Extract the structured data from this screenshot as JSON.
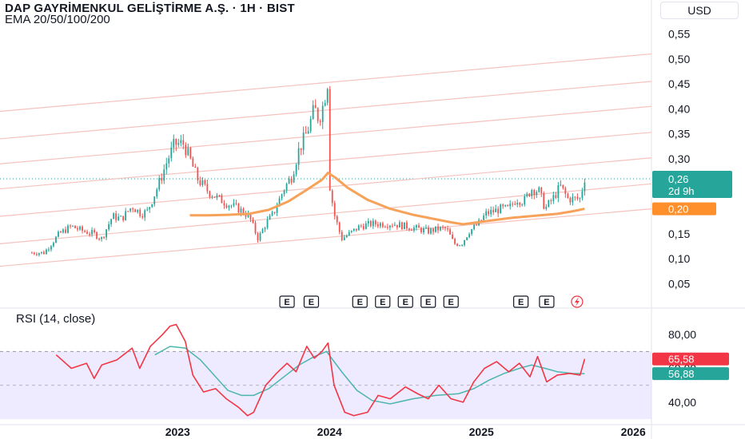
{
  "header": {
    "title": "DAP GAYRİMENKUL GELİŞTİRME A.Ş. · 1H · BIST",
    "indicator": "EMA 20/50/100/200",
    "currency": "USD"
  },
  "rsi_panel": {
    "label": "RSI (14, close)",
    "value_label": "65,58",
    "ma_label": "56,88",
    "hidden_level_label": "60,00"
  },
  "price_badges": {
    "last_price": "0,26",
    "countdown": "2d 9h",
    "ema_price": "0,20"
  },
  "event_markers": [
    "E",
    "E",
    "E",
    "E",
    "E",
    "E",
    "E",
    "E",
    "E"
  ],
  "colors": {
    "up": "#26a69a",
    "down": "#ef5350",
    "ema": "#f7a25a",
    "channel": "#f5c2bd",
    "rsi_line": "#f23645",
    "rsi_ma": "#4db6ac",
    "rsi_band": "#eeeaff",
    "last_price_badge": "#26a69a",
    "ema_badge": "#ff8f2a",
    "rsi_badge": "#f23645",
    "rsi_ma_badge": "#26a69a"
  },
  "chart_data": [
    {
      "type": "candlestick",
      "title": "DAP GAYRİMENKUL GELİŞTİRME A.Ş. · 1H · BIST",
      "y_ticks": [
        "0,55",
        "0,50",
        "0,45",
        "0,40",
        "0,35",
        "0,30",
        "0,25",
        "0,20",
        "0,15",
        "0,10",
        "0,05"
      ],
      "y_values": [
        0.55,
        0.5,
        0.45,
        0.4,
        0.35,
        0.3,
        0.25,
        0.2,
        0.15,
        0.1,
        0.05
      ],
      "x_ticks": [
        "2023",
        "2024",
        "2025",
        "2026"
      ],
      "x_tick_years": [
        2023,
        2024,
        2025,
        2026
      ],
      "ylim": [
        0.03,
        0.57
      ],
      "xlim": [
        2021.83,
        2026.12
      ],
      "last_price": 0.26,
      "ema_value": 0.2,
      "close_path": [
        [
          2022.04,
          0.112
        ],
        [
          2022.12,
          0.112
        ],
        [
          2022.22,
          0.15
        ],
        [
          2022.3,
          0.165
        ],
        [
          2022.38,
          0.155
        ],
        [
          2022.45,
          0.15
        ],
        [
          2022.5,
          0.14
        ],
        [
          2022.57,
          0.185
        ],
        [
          2022.63,
          0.18
        ],
        [
          2022.7,
          0.205
        ],
        [
          2022.76,
          0.19
        ],
        [
          2022.8,
          0.195
        ],
        [
          2022.87,
          0.245
        ],
        [
          2022.93,
          0.295
        ],
        [
          2022.98,
          0.33
        ],
        [
          2023.04,
          0.33
        ],
        [
          2023.08,
          0.3
        ],
        [
          2023.13,
          0.26
        ],
        [
          2023.2,
          0.235
        ],
        [
          2023.27,
          0.22
        ],
        [
          2023.33,
          0.21
        ],
        [
          2023.4,
          0.2
        ],
        [
          2023.47,
          0.185
        ],
        [
          2023.53,
          0.14
        ],
        [
          2023.58,
          0.17
        ],
        [
          2023.63,
          0.19
        ],
        [
          2023.7,
          0.24
        ],
        [
          2023.75,
          0.265
        ],
        [
          2023.8,
          0.32
        ],
        [
          2023.84,
          0.345
        ],
        [
          2023.87,
          0.37
        ],
        [
          2023.9,
          0.4
        ],
        [
          2023.93,
          0.38
        ],
        [
          2023.96,
          0.41
        ],
        [
          2023.99,
          0.46
        ],
        [
          2024.0,
          0.25
        ],
        [
          2024.03,
          0.19
        ],
        [
          2024.08,
          0.14
        ],
        [
          2024.13,
          0.15
        ],
        [
          2024.2,
          0.165
        ],
        [
          2024.28,
          0.17
        ],
        [
          2024.35,
          0.17
        ],
        [
          2024.42,
          0.17
        ],
        [
          2024.5,
          0.165
        ],
        [
          2024.58,
          0.16
        ],
        [
          2024.65,
          0.155
        ],
        [
          2024.72,
          0.16
        ],
        [
          2024.77,
          0.16
        ],
        [
          2024.82,
          0.13
        ],
        [
          2024.87,
          0.13
        ],
        [
          2024.92,
          0.155
        ],
        [
          2024.98,
          0.17
        ],
        [
          2025.03,
          0.19
        ],
        [
          2025.08,
          0.195
        ],
        [
          2025.13,
          0.2
        ],
        [
          2025.18,
          0.2
        ],
        [
          2025.23,
          0.22
        ],
        [
          2025.28,
          0.215
        ],
        [
          2025.33,
          0.24
        ],
        [
          2025.38,
          0.235
        ],
        [
          2025.42,
          0.2
        ],
        [
          2025.47,
          0.22
        ],
        [
          2025.52,
          0.245
        ],
        [
          2025.57,
          0.22
        ],
        [
          2025.6,
          0.22
        ],
        [
          2025.65,
          0.22
        ],
        [
          2025.68,
          0.262
        ]
      ],
      "ema": [
        [
          2023.08,
          0.187
        ],
        [
          2023.2,
          0.187
        ],
        [
          2023.33,
          0.188
        ],
        [
          2023.47,
          0.19
        ],
        [
          2023.6,
          0.198
        ],
        [
          2023.73,
          0.215
        ],
        [
          2023.85,
          0.238
        ],
        [
          2023.95,
          0.258
        ],
        [
          2023.99,
          0.272
        ],
        [
          2024.04,
          0.262
        ],
        [
          2024.12,
          0.242
        ],
        [
          2024.25,
          0.218
        ],
        [
          2024.4,
          0.2
        ],
        [
          2024.55,
          0.188
        ],
        [
          2024.7,
          0.179
        ],
        [
          2024.8,
          0.173
        ],
        [
          2024.88,
          0.169
        ],
        [
          2024.95,
          0.172
        ],
        [
          2025.05,
          0.176
        ],
        [
          2025.2,
          0.182
        ],
        [
          2025.35,
          0.186
        ],
        [
          2025.5,
          0.19
        ],
        [
          2025.6,
          0.195
        ],
        [
          2025.68,
          0.2
        ]
      ],
      "channel_lines": [
        [
          [
            2021.83,
            0.085
          ],
          [
            2026.12,
            0.2
          ]
        ],
        [
          [
            2021.83,
            0.13
          ],
          [
            2026.12,
            0.25
          ]
        ],
        [
          [
            2021.83,
            0.185
          ],
          [
            2026.12,
            0.302
          ]
        ],
        [
          [
            2021.83,
            0.24
          ],
          [
            2026.12,
            0.353
          ]
        ],
        [
          [
            2021.83,
            0.29
          ],
          [
            2026.12,
            0.405
          ]
        ],
        [
          [
            2021.83,
            0.34
          ],
          [
            2026.12,
            0.455
          ]
        ],
        [
          [
            2021.83,
            0.395
          ],
          [
            2026.12,
            0.51
          ]
        ]
      ],
      "event_dates": [
        2023.72,
        2023.88,
        2024.2,
        2024.35,
        2024.5,
        2024.65,
        2024.8,
        2025.26,
        2025.43
      ],
      "event_lightning_date": 2025.63
    },
    {
      "type": "line",
      "title": "RSI (14, close)",
      "y_ticks": [
        "80,00",
        "60,00",
        "40,00"
      ],
      "y_values": [
        80,
        60,
        40
      ],
      "ylim": [
        30,
        90
      ],
      "band": [
        30,
        70
      ],
      "rsi_value": 65.58,
      "rsi_ma_value": 56.88,
      "rsi": [
        [
          2022.2,
          68
        ],
        [
          2022.3,
          60
        ],
        [
          2022.4,
          63
        ],
        [
          2022.45,
          54
        ],
        [
          2022.5,
          62
        ],
        [
          2022.6,
          65
        ],
        [
          2022.7,
          72
        ],
        [
          2022.75,
          60
        ],
        [
          2022.82,
          73
        ],
        [
          2022.9,
          80
        ],
        [
          2022.95,
          85
        ],
        [
          2022.99,
          86
        ],
        [
          2023.05,
          76
        ],
        [
          2023.1,
          56
        ],
        [
          2023.17,
          46
        ],
        [
          2023.25,
          48
        ],
        [
          2023.32,
          42
        ],
        [
          2023.4,
          37
        ],
        [
          2023.46,
          32
        ],
        [
          2023.5,
          34
        ],
        [
          2023.58,
          50
        ],
        [
          2023.65,
          57
        ],
        [
          2023.72,
          63
        ],
        [
          2023.78,
          58
        ],
        [
          2023.85,
          73
        ],
        [
          2023.9,
          66
        ],
        [
          2023.95,
          70
        ],
        [
          2023.99,
          75
        ],
        [
          2024.03,
          50
        ],
        [
          2024.1,
          34
        ],
        [
          2024.16,
          32
        ],
        [
          2024.25,
          34
        ],
        [
          2024.32,
          44
        ],
        [
          2024.4,
          42
        ],
        [
          2024.5,
          49
        ],
        [
          2024.58,
          45
        ],
        [
          2024.65,
          42
        ],
        [
          2024.72,
          50
        ],
        [
          2024.8,
          42
        ],
        [
          2024.88,
          40
        ],
        [
          2024.95,
          52
        ],
        [
          2025.02,
          60
        ],
        [
          2025.1,
          64
        ],
        [
          2025.18,
          58
        ],
        [
          2025.25,
          63
        ],
        [
          2025.32,
          55
        ],
        [
          2025.37,
          67
        ],
        [
          2025.43,
          52
        ],
        [
          2025.5,
          56
        ],
        [
          2025.58,
          57
        ],
        [
          2025.65,
          56
        ],
        [
          2025.68,
          65.58
        ]
      ],
      "rsi_ma": [
        [
          2022.85,
          68
        ],
        [
          2022.95,
          73
        ],
        [
          2023.05,
          72
        ],
        [
          2023.15,
          65
        ],
        [
          2023.25,
          55
        ],
        [
          2023.33,
          47
        ],
        [
          2023.42,
          44
        ],
        [
          2023.5,
          44
        ],
        [
          2023.6,
          48
        ],
        [
          2023.7,
          55
        ],
        [
          2023.8,
          62
        ],
        [
          2023.9,
          67
        ],
        [
          2023.98,
          70
        ],
        [
          2024.08,
          58
        ],
        [
          2024.18,
          47
        ],
        [
          2024.28,
          41
        ],
        [
          2024.4,
          39
        ],
        [
          2024.55,
          42
        ],
        [
          2024.7,
          44
        ],
        [
          2024.85,
          45
        ],
        [
          2024.95,
          48
        ],
        [
          2025.05,
          53
        ],
        [
          2025.15,
          57
        ],
        [
          2025.25,
          60
        ],
        [
          2025.33,
          62
        ],
        [
          2025.42,
          60
        ],
        [
          2025.5,
          58
        ],
        [
          2025.6,
          57
        ],
        [
          2025.68,
          56.88
        ]
      ]
    }
  ]
}
